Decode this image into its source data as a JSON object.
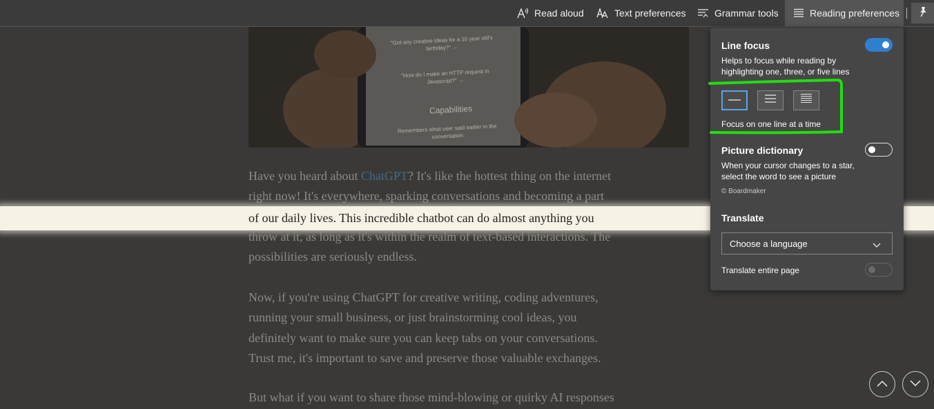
{
  "toolbar": {
    "read_aloud": "Read aloud",
    "text_preferences": "Text preferences",
    "grammar_tools": "Grammar tools",
    "reading_preferences": "Reading preferences"
  },
  "hero_image": {
    "line1": "\"Got any creative ideas for a 10 year old's birthday?\" →",
    "line2": "\"How do I make an HTTP request in Javascript?\" →",
    "capabilities": "Capabilities",
    "line3": "Remembers what user said earlier in the conversation"
  },
  "article": {
    "p1_before": "Have you heard about ",
    "p1_link": "ChatGPT",
    "p1_after": "? It's like the hottest thing on the internet",
    "p1_line2": "right now! It's everywhere, sparking conversations and becoming a part",
    "p1_line3": "of our daily lives. This incredible chatbot can do almost anything you",
    "p1_line4": "throw at it, as long as it's within the realm of text-based interactions. The",
    "p1_line5": "possibilities are seriously endless.",
    "p2_line1": "Now, if you're using ChatGPT for creative writing, coding adventures,",
    "p2_line2": "running your small business, or just brainstorming cool ideas, you",
    "p2_line3": "definitely want to make sure you can keep tabs on your conversations.",
    "p2_line4": "Trust me, it's important to save and preserve those valuable exchanges.",
    "p3_line1": "But what if you want to share those mind-blowing or quirky AI responses"
  },
  "panel": {
    "line_focus": {
      "title": "Line focus",
      "description": "Helps to focus while reading by highlighting one, three, or five lines",
      "enabled": true,
      "status": "Focus on one line at a time",
      "selected_option": "one line"
    },
    "picture_dictionary": {
      "title": "Picture dictionary",
      "description": "When your cursor changes to a star, select the word to see a picture",
      "credit": "© Boardmaker",
      "enabled": false
    },
    "translate": {
      "title": "Translate",
      "language_placeholder": "Choose a language",
      "entire_page_label": "Translate entire page",
      "entire_page_enabled": false
    }
  },
  "colors": {
    "toggle_on": "#2f7fd0",
    "selected_border": "#5aa3e6",
    "annotation_green": "#22dd11"
  }
}
